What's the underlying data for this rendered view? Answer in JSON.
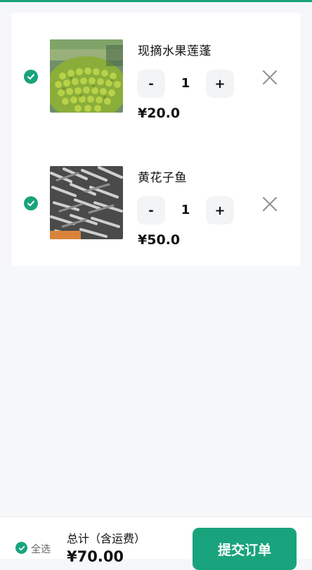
{
  "colors": {
    "accent": "#19a37d"
  },
  "cart": {
    "items": [
      {
        "title": "现摘水果莲蓬",
        "quantity": "1",
        "price": "¥20.0",
        "minus_label": "-",
        "plus_label": "+",
        "image": "green-beans-in-basket"
      },
      {
        "title": "黄花子鱼",
        "quantity": "1",
        "price": "¥50.0",
        "minus_label": "-",
        "plus_label": "+",
        "image": "small-dried-fish"
      }
    ]
  },
  "footer": {
    "select_all_label": "全选",
    "total_label": "总计（含运费）",
    "total_value": "¥70.00",
    "submit_label": "提交订单"
  }
}
